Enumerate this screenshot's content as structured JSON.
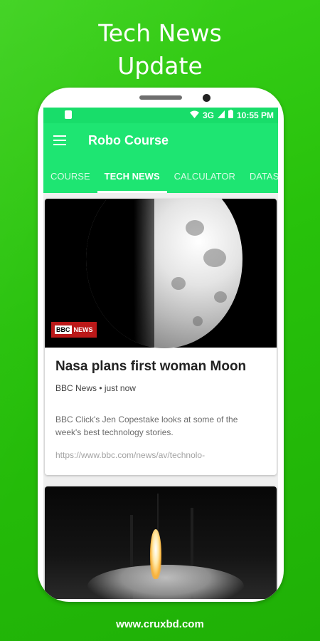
{
  "promo": {
    "headline_line1": "Tech News",
    "headline_line2": "Update",
    "footer_url": "www.cruxbd.com"
  },
  "status_bar": {
    "network": "3G",
    "time": "10:55 PM"
  },
  "app_bar": {
    "title": "Robo Course",
    "menu_icon": "hamburger-menu-icon"
  },
  "tabs": [
    {
      "label": "COURSE",
      "active": false
    },
    {
      "label": "TECH NEWS",
      "active": true
    },
    {
      "label": "CALCULATOR",
      "active": false
    },
    {
      "label": "DATASHEET",
      "active": false
    }
  ],
  "articles": [
    {
      "title": "Nasa plans first woman Moon",
      "source": "BBC News",
      "time": "just now",
      "meta": "BBC News • just now",
      "description": "BBC Click's Jen Copestake looks at some of the week's best technology stories.",
      "link": "https://www.bbc.com/news/av/technolo-",
      "badge": "BBC NEWS",
      "badge_box": "BBC",
      "badge_text": "NEWS"
    },
    {
      "image": "rocket-launch"
    }
  ],
  "colors": {
    "background": "#27c10b",
    "app_bar": "#1ee572",
    "status_bar": "#18dd6a"
  }
}
